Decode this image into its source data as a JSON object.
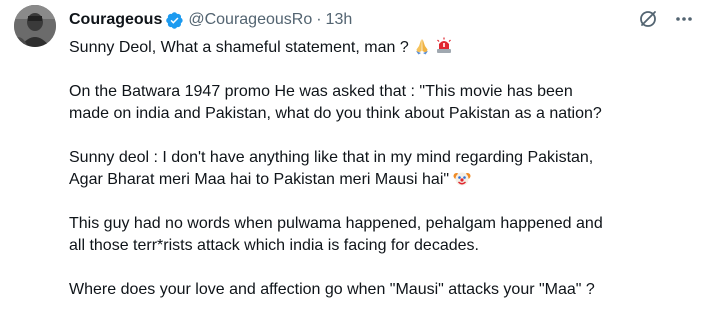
{
  "author": {
    "display_name": "Courageous",
    "handle": "@CourageousRo",
    "separator": "·",
    "time": "13h",
    "verified_color": "#1d9bf0"
  },
  "actions": {
    "grok_icon": "grok-icon",
    "more_icon": "more-icon"
  },
  "tweet": {
    "line1": "Sunny Deol, What a shameful statement, man ?",
    "line2": "On the Batwara 1947 promo He was asked that : \"This movie has been",
    "line3": "made on india and Pakistan, what do you think about Pakistan as a nation?",
    "line4": "Sunny deol : I don't have anything like that in my mind regarding Pakistan,",
    "line5": "Agar Bharat meri Maa hai to Pakistan meri Mausi hai\"",
    "line6": "This guy had no words when pulwama happened, pehalgam happened and",
    "line7": "all those terr*rists attack which india is facing for decades.",
    "line8": "Where does your love and affection go when \"Mausi\" attacks your \"Maa\" ?"
  },
  "emojis": [
    "folded-hands",
    "police-light",
    "clown-face"
  ]
}
